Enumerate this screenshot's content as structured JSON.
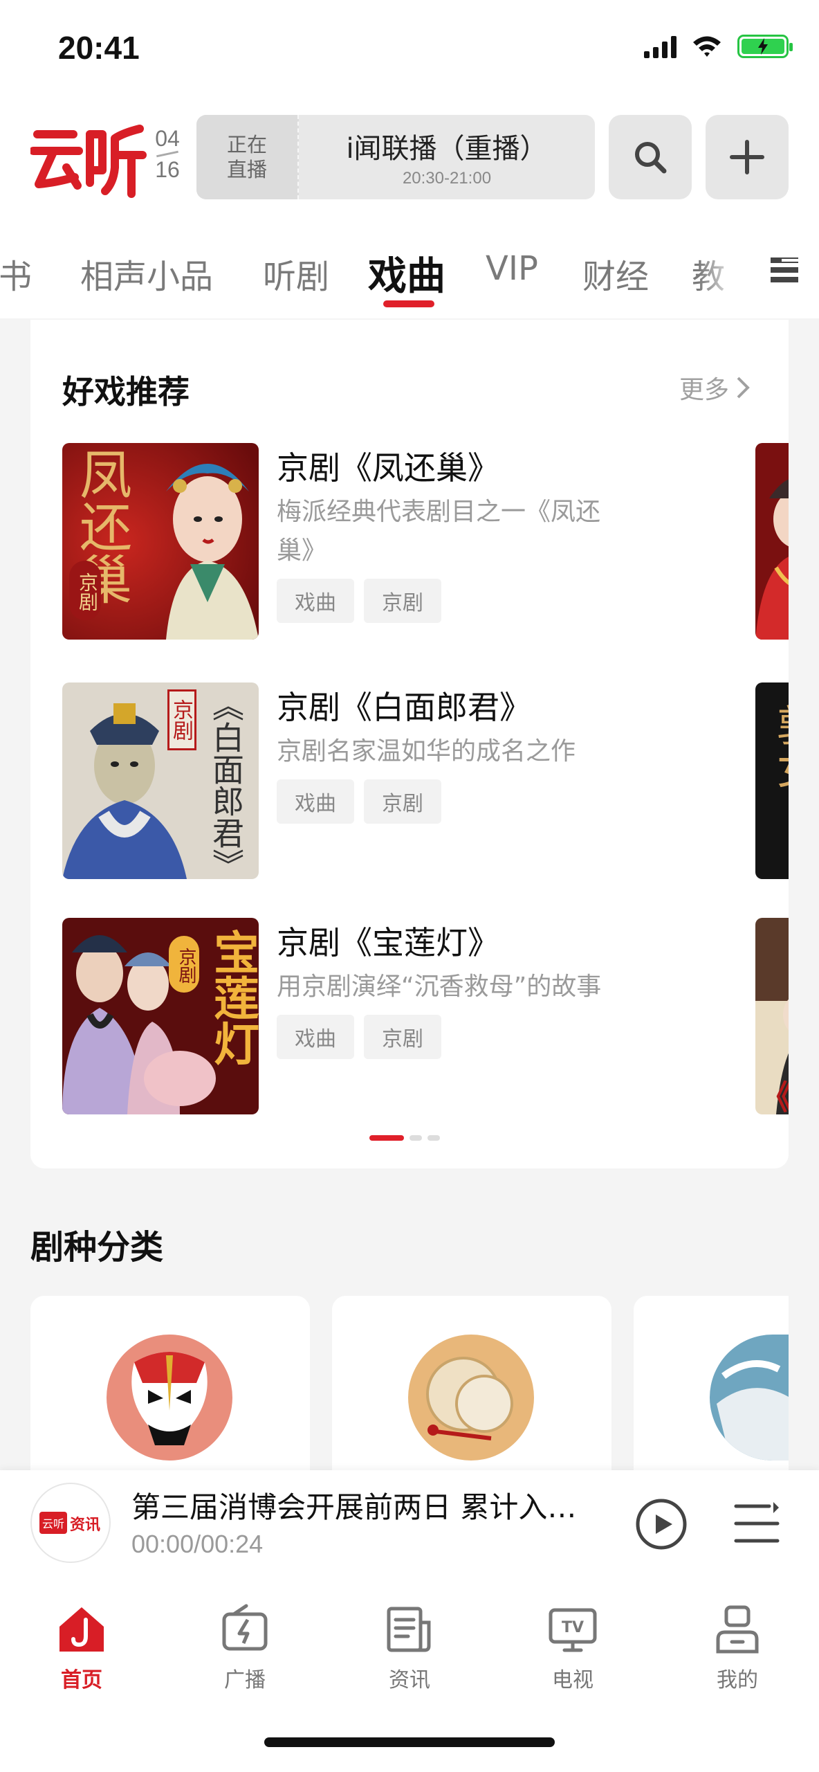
{
  "status_bar": {
    "time": "20:41"
  },
  "header": {
    "logo_text": "云听",
    "date_month": "04",
    "date_day": "16",
    "live_tag_line1": "正在",
    "live_tag_line2": "直播",
    "live_program": "i闻联播（重播）",
    "live_time": "20:30-21:00"
  },
  "tabs": {
    "items": [
      "书",
      "相声小品",
      "听剧",
      "戏曲",
      "VIP",
      "财经",
      "教"
    ],
    "active": "戏曲"
  },
  "recommend": {
    "title": "好戏推荐",
    "more": "更多",
    "items": [
      {
        "title": "京剧《凤还巢》",
        "desc": "梅派经典代表剧目之一《凤还巢》",
        "tags": [
          "戏曲",
          "京剧"
        ],
        "cover_text": "凤还巢",
        "cover_badge": "京剧"
      },
      {
        "title": "京剧《白面郎君》",
        "desc": "京剧名家温如华的成名之作",
        "tags": [
          "戏曲",
          "京剧"
        ],
        "cover_text": "《白面郎君》",
        "cover_badge": "京剧"
      },
      {
        "title": "京剧《宝莲灯》",
        "desc": "用京剧演绎“沉香救母”的故事",
        "tags": [
          "戏曲",
          "京剧"
        ],
        "cover_text": "宝莲灯",
        "cover_badge": "京剧"
      }
    ],
    "peek_texts": [
      "",
      "敦女",
      "《王"
    ],
    "pagination": {
      "current": 1,
      "total": 3
    }
  },
  "genre": {
    "title": "剧种分类"
  },
  "player": {
    "logo_text": "云听资讯",
    "title": "第三届消博会开展前两日 累计入…",
    "time": "00:00/00:24"
  },
  "bottom_nav": {
    "items": [
      {
        "label": "首页",
        "icon": "home-icon"
      },
      {
        "label": "广播",
        "icon": "radio-icon"
      },
      {
        "label": "资讯",
        "icon": "news-icon"
      },
      {
        "label": "电视",
        "icon": "tv-icon"
      },
      {
        "label": "我的",
        "icon": "profile-icon"
      }
    ],
    "active": "首页"
  },
  "colors": {
    "accent": "#e0202a",
    "brand": "#d81e26",
    "background": "#f4f4f4"
  }
}
